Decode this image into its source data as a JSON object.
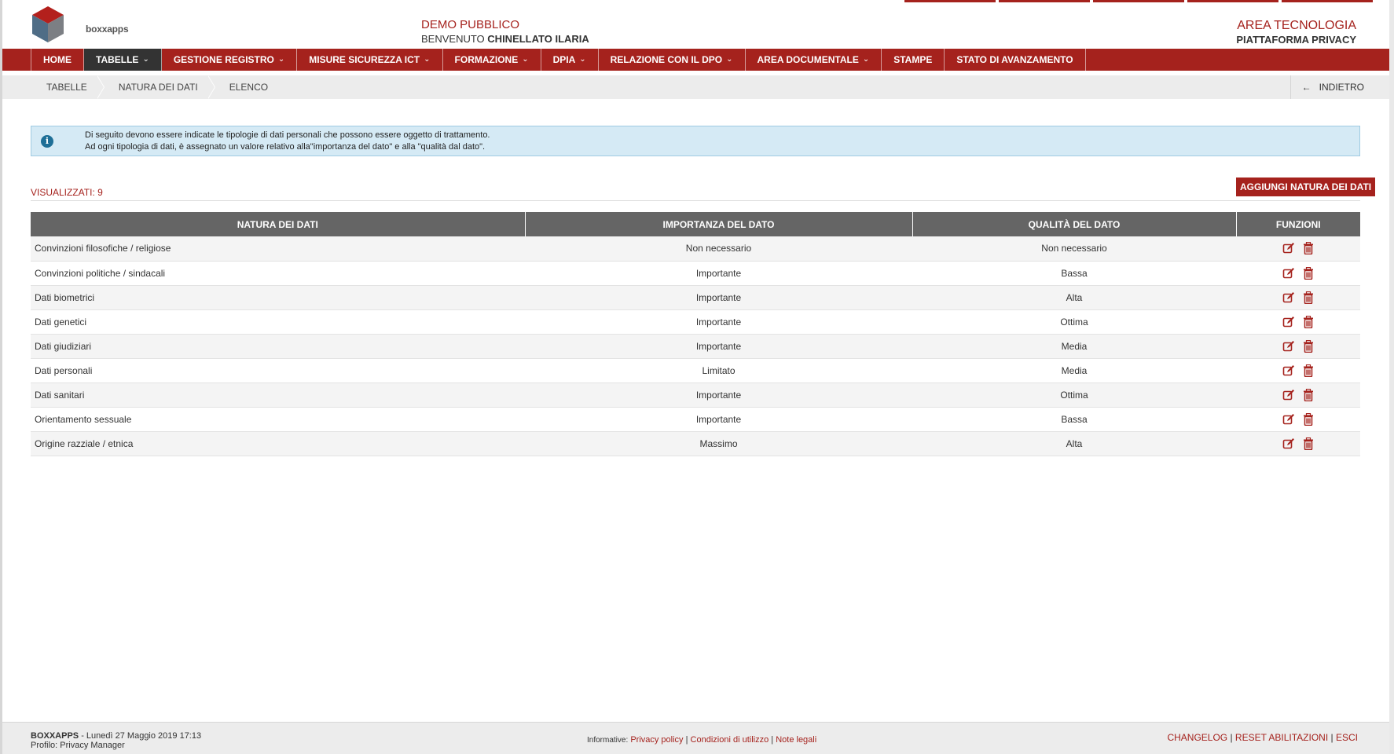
{
  "header": {
    "logo_text": "boxxapps",
    "center_title": "DEMO PUBBLICO",
    "welcome_prefix": "BENVENUTO",
    "user_name": "CHINELLATO ILARIA",
    "right_title": "AREA TECNOLOGIA",
    "right_subtitle": "PIATTAFORMA PRIVACY"
  },
  "nav": [
    {
      "label": "HOME",
      "dropdown": false
    },
    {
      "label": "TABELLE",
      "dropdown": true,
      "active": true
    },
    {
      "label": "GESTIONE REGISTRO",
      "dropdown": true
    },
    {
      "label": "MISURE SICUREZZA ICT",
      "dropdown": true
    },
    {
      "label": "FORMAZIONE",
      "dropdown": true
    },
    {
      "label": "DPIA",
      "dropdown": true
    },
    {
      "label": "RELAZIONE CON IL DPO",
      "dropdown": true
    },
    {
      "label": "AREA DOCUMENTALE",
      "dropdown": true
    },
    {
      "label": "STAMPE",
      "dropdown": false
    },
    {
      "label": "STATO DI AVANZAMENTO",
      "dropdown": false
    }
  ],
  "breadcrumb": [
    "TABELLE",
    "NATURA DEI DATI",
    "ELENCO"
  ],
  "back_label": "INDIETRO",
  "info": {
    "line1": "Di seguito devono essere indicate le tipologie di dati personali che possono essere oggetto di trattamento.",
    "line2": "Ad ogni tipologia di dati, è assegnato un valore relativo alla\"importanza del dato\" e alla \"qualità dal dato\"."
  },
  "count_label": "VISUALIZZATI: 9",
  "add_button": "AGGIUNGI NATURA DEI DATI",
  "table": {
    "headers": [
      "NATURA DEI DATI",
      "IMPORTANZA DEL DATO",
      "QUALITÀ DEL DATO",
      "FUNZIONI"
    ],
    "rows": [
      [
        "Convinzioni filosofiche / religiose",
        "Non necessario",
        "Non necessario"
      ],
      [
        "Convinzioni politiche / sindacali",
        "Importante",
        "Bassa"
      ],
      [
        "Dati biometrici",
        "Importante",
        "Alta"
      ],
      [
        "Dati genetici",
        "Importante",
        "Ottima"
      ],
      [
        "Dati giudiziari",
        "Importante",
        "Media"
      ],
      [
        "Dati personali",
        "Limitato",
        "Media"
      ],
      [
        "Dati sanitari",
        "Importante",
        "Ottima"
      ],
      [
        "Orientamento sessuale",
        "Importante",
        "Bassa"
      ],
      [
        "Origine razziale / etnica",
        "Massimo",
        "Alta"
      ]
    ]
  },
  "footer": {
    "brand": "BOXXAPPS",
    "datetime": "- Lunedì 27 Maggio 2019 17:13",
    "profile": "Profilo: Privacy Manager",
    "informative_label": "Informative:",
    "privacy_policy": "Privacy policy",
    "conditions": "Condizioni di utilizzo",
    "legal": "Note legali",
    "changelog": "CHANGELOG",
    "reset": "RESET ABILITAZIONI",
    "exit": "ESCI"
  },
  "colors": {
    "accent": "#a5221d",
    "header_table": "#656565",
    "info_bg": "#d5eaf5",
    "active_nav": "#333333"
  },
  "icons": [
    "edit-icon",
    "trash-icon",
    "info-icon",
    "arrow-left-icon",
    "chevron-down-icon",
    "cube-logo-icon"
  ]
}
